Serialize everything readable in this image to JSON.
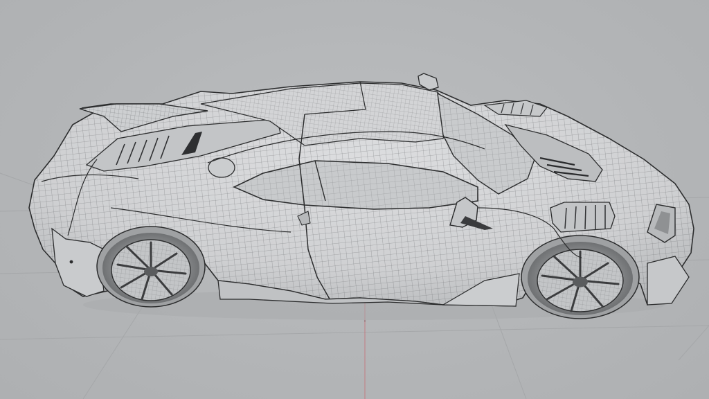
{
  "viewport": {
    "view_mode": "wireframe-on-shaded",
    "background_color": "#b3b5b7",
    "grid_color": "#a4a6a8",
    "axis_color": "#c27b82"
  },
  "model": {
    "subject": "supercar",
    "body_color": "#d1d2d3",
    "shadow_color": "#9c9ea0",
    "wire_color": "#5d5f61",
    "edge_color": "#2b2c2d"
  }
}
